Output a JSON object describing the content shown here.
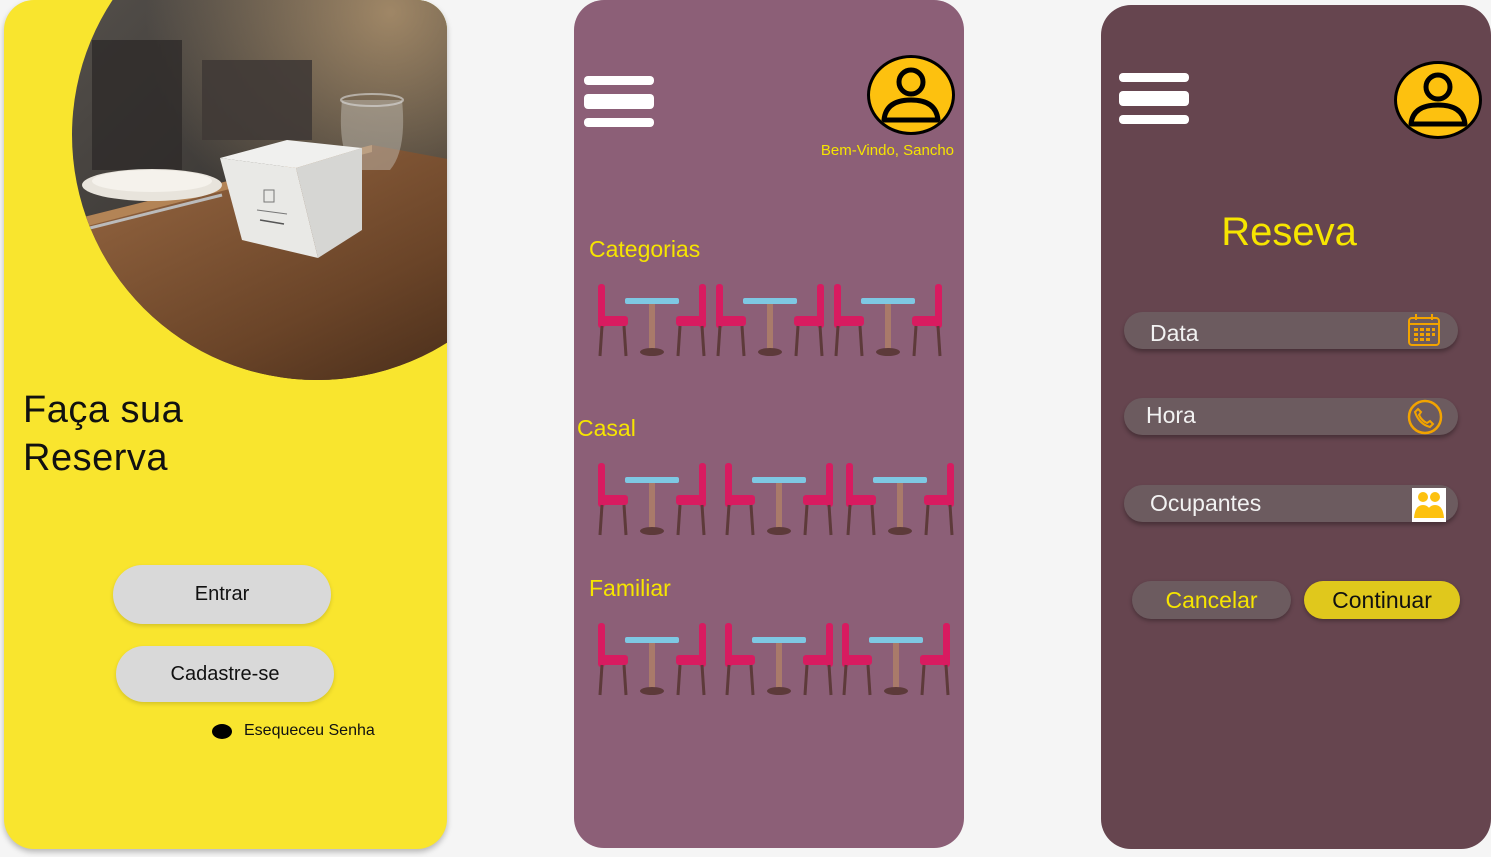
{
  "screen_login": {
    "headline_line1": "Faça sua",
    "headline_line2": "Reserva",
    "enter_label": "Entrar",
    "signup_label": "Cadastre-se",
    "forgot_label": "Esequeceu Senha"
  },
  "screen_categories": {
    "welcome": "Bem-Vindo, Sancho",
    "categories_heading": "Categorias",
    "couple_heading": "Casal",
    "family_heading": "Familiar"
  },
  "screen_reservation": {
    "title": "Reseva",
    "fields": [
      {
        "label": "Data",
        "icon": "calendar-icon"
      },
      {
        "label": "Hora",
        "icon": "clock-icon"
      },
      {
        "label": "Ocupantes",
        "icon": "people-icon"
      }
    ],
    "cancel_label": "Cancelar",
    "continue_label": "Continuar"
  },
  "colors": {
    "login_bg": "#f9e52e",
    "categories_bg": "#8c5f77",
    "reservation_bg": "#66454f",
    "accent_yellow": "#f6e500",
    "chair_pink": "#d81b60",
    "table_blue": "#7ec8e3",
    "avatar_yellow": "#fdc10f"
  }
}
